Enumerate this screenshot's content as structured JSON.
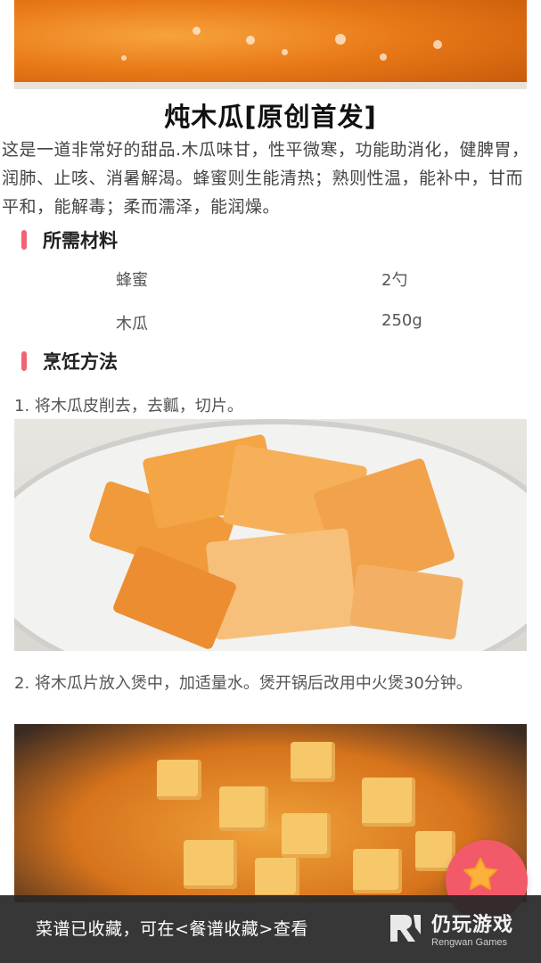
{
  "recipe": {
    "title": "炖木瓜[原创首发]",
    "intro": "这是一道非常好的甜品.木瓜味甘，性平微寒，功能助消化，健脾胃，润肺、止咳、消暑解渴。蜂蜜则生能清热；熟则性温，能补中，甘而平和，能解毒；柔而濡泽，能润燥。"
  },
  "ingredients": {
    "heading": "所需材料",
    "items": [
      {
        "name": "蜂蜜",
        "amount": "2勺"
      },
      {
        "name": "木瓜",
        "amount": "250g"
      }
    ]
  },
  "method": {
    "heading": "烹饪方法",
    "steps": [
      {
        "text": "1. 将木瓜皮削去，去瓤，切片。"
      },
      {
        "text": "2. 将木瓜片放入煲中，加适量水。煲开锅后改用中火煲30分钟。"
      }
    ]
  },
  "fab": {
    "icon": "star-icon",
    "color": "#f25a6a"
  },
  "toast": {
    "message": "菜谱已收藏，可在<餐谱收藏>查看"
  },
  "watermark": {
    "name": "仍玩游戏",
    "sub": "Rengwan Games"
  },
  "colors": {
    "accent": "#f06474"
  }
}
